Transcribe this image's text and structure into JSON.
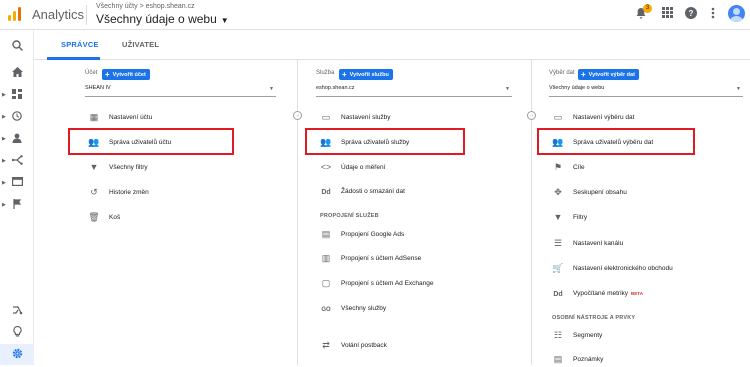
{
  "header": {
    "app_title": "Analytics",
    "breadcrumb": "Všechny účty > eshop.shean.cz",
    "property_title": "Všechny údaje o webu",
    "notification_count": "3"
  },
  "icons": {
    "logo": "analytics-logo",
    "notifications": "bell-icon",
    "apps": "apps-grid-icon",
    "help": "help-icon",
    "more": "more-vert-icon",
    "account": "avatar"
  },
  "tabs": [
    {
      "label": "SPRÁVCE",
      "active": true
    },
    {
      "label": "UŽIVATEL",
      "active": false
    }
  ],
  "account_column": {
    "header_label": "Účet",
    "create_label": "Vytvořit účet",
    "selector_value": "SHEAN IV",
    "items": [
      {
        "label": "Nastavení účtu",
        "icon": "building-icon"
      },
      {
        "label": "Správa uživatelů účtu",
        "icon": "people-icon"
      },
      {
        "label": "Všechny filtry",
        "icon": "filter-icon"
      },
      {
        "label": "Historie změn",
        "icon": "history-icon"
      },
      {
        "label": "Koš",
        "icon": "trash-icon"
      }
    ]
  },
  "property_column": {
    "header_label": "Služba",
    "create_label": "Vytvořit službu",
    "selector_value": "eshop.shean.cz",
    "items": [
      {
        "label": "Nastavení služby",
        "icon": "layout-icon"
      },
      {
        "label": "Správa uživatelů služby",
        "icon": "people-icon"
      },
      {
        "label": "Údaje o měření",
        "icon": "code-icon"
      },
      {
        "label": "Žádosti o smazání dat",
        "icon": "dd-icon"
      }
    ],
    "section_label": "PROPOJENÍ SLUŽEB",
    "linked_items": [
      {
        "label": "Propojení Google Ads",
        "icon": "ads-icon"
      },
      {
        "label": "Propojení s účtem AdSense",
        "icon": "adsense-icon"
      },
      {
        "label": "Propojení s účtem Ad Exchange",
        "icon": "adexchange-icon"
      },
      {
        "label": "Všechny služby",
        "icon": "all-products-icon"
      },
      {
        "label": "Volání postback",
        "icon": "postback-icon"
      }
    ]
  },
  "view_column": {
    "header_label": "Výběr dat",
    "create_label": "Vytvořit výběr dat",
    "selector_value": "Všechny údaje o webu",
    "items": [
      {
        "label": "Nastavení výběru dat",
        "icon": "layout-icon"
      },
      {
        "label": "Správa uživatelů výběru dat",
        "icon": "people-icon"
      },
      {
        "label": "Cíle",
        "icon": "flag-icon"
      },
      {
        "label": "Seskupení obsahu",
        "icon": "content-grouping-icon"
      },
      {
        "label": "Filtry",
        "icon": "filter-icon"
      },
      {
        "label": "Nastavení kanálu",
        "icon": "channel-icon"
      },
      {
        "label": "Nastavení elektronického obchodu",
        "icon": "cart-icon"
      },
      {
        "label": "Vypočítané metriky",
        "icon": "dd-icon",
        "badge": "BETA"
      }
    ],
    "section_label": "OSOBNÍ NÁSTROJE A PRVKY",
    "tool_items": [
      {
        "label": "Segmenty",
        "icon": "segments-icon"
      },
      {
        "label": "Poznámky",
        "icon": "notes-icon"
      }
    ]
  },
  "colors": {
    "accent": "#1a73e8",
    "highlight": "#e01b24",
    "logo": "#f9ab00"
  }
}
